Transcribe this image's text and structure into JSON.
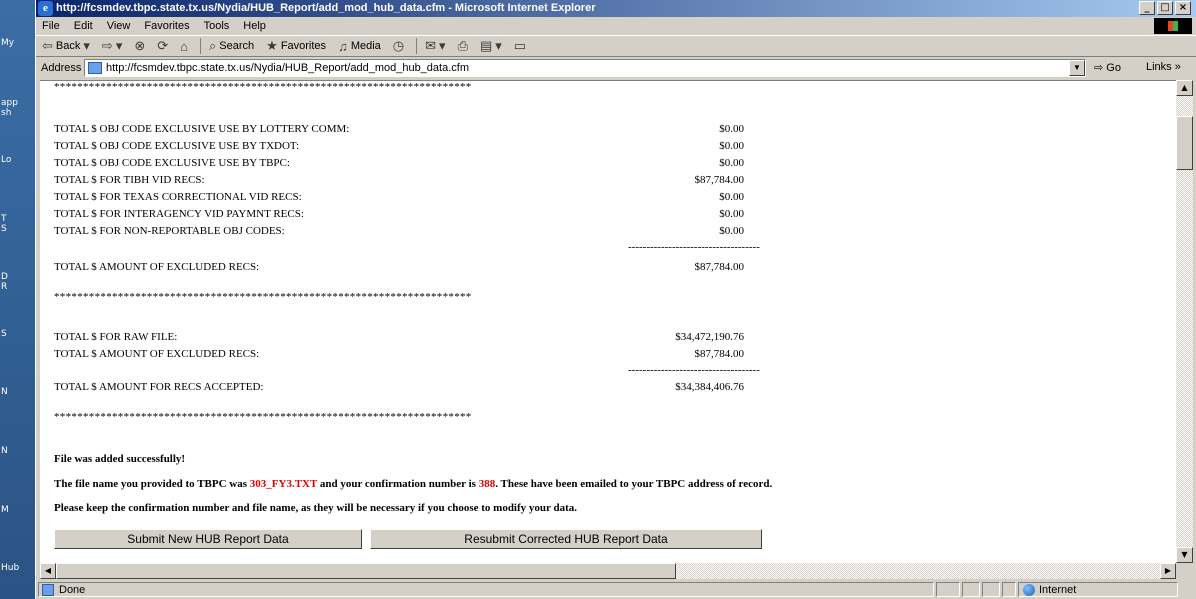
{
  "desktop": {
    "labels": [
      "My",
      "app",
      "sh",
      "Lo",
      "T",
      "S",
      "D",
      "R",
      "S",
      "N",
      "N",
      "M",
      "Hub"
    ]
  },
  "window": {
    "title": "http://fcsmdev.tbpc.state.tx.us/Nydia/HUB_Report/add_mod_hub_data.cfm - Microsoft Internet Explorer"
  },
  "menu": [
    "File",
    "Edit",
    "View",
    "Favorites",
    "Tools",
    "Help"
  ],
  "toolbar": {
    "back": "Back",
    "search": "Search",
    "favorites": "Favorites",
    "media": "Media"
  },
  "address": {
    "label": "Address",
    "url": "http://fcsmdev.tbpc.state.tx.us/Nydia/HUB_Report/add_mod_hub_data.cfm",
    "go": "Go",
    "links": "Links"
  },
  "report": {
    "stars": "************************************************************************",
    "dashes": "------------------------------------",
    "exclusions": [
      {
        "label": "TOTAL $ OBJ CODE EXCLUSIVE USE BY LOTTERY COMM:",
        "value": "$0.00"
      },
      {
        "label": "TOTAL $ OBJ CODE EXCLUSIVE USE BY TXDOT:",
        "value": "$0.00"
      },
      {
        "label": "TOTAL $ OBJ CODE EXCLUSIVE USE BY TBPC:",
        "value": "$0.00"
      },
      {
        "label": "TOTAL $ FOR TIBH VID RECS:",
        "value": "$87,784.00"
      },
      {
        "label": "TOTAL $ FOR TEXAS CORRECTIONAL VID RECS:",
        "value": "$0.00"
      },
      {
        "label": "TOTAL $ FOR INTERAGENCY VID PAYMNT RECS:",
        "value": "$0.00"
      },
      {
        "label": "TOTAL $ FOR NON-REPORTABLE OBJ CODES:",
        "value": "$0.00"
      }
    ],
    "excluded_total": {
      "label": "TOTAL $ AMOUNT OF EXCLUDED RECS:",
      "value": "$87,784.00"
    },
    "raw_file": {
      "label": "TOTAL $ FOR RAW FILE:",
      "value": "$34,472,190.76"
    },
    "excluded_total_2": {
      "label": "TOTAL $ AMOUNT OF EXCLUDED RECS:",
      "value": "$87,784.00"
    },
    "accepted_total": {
      "label": "TOTAL $ AMOUNT FOR RECS ACCEPTED:",
      "value": "$34,384,406.76"
    }
  },
  "messages": {
    "success": "File was added successfully!",
    "file_prefix": "The file name you provided to TBPC was ",
    "file_name": "303_FY3.TXT",
    "conf_middle": " and your confirmation number is ",
    "conf_number": "388",
    "conf_suffix": ". These have been emailed to your TBPC address of record.",
    "keep_note": "Please keep the confirmation number and file name, as they will be necessary if you choose to modify your data."
  },
  "buttons": {
    "submit_new": "Submit New HUB Report Data",
    "resubmit": "Resubmit Corrected HUB Report Data"
  },
  "status": {
    "text": "Done",
    "zone": "Internet"
  }
}
